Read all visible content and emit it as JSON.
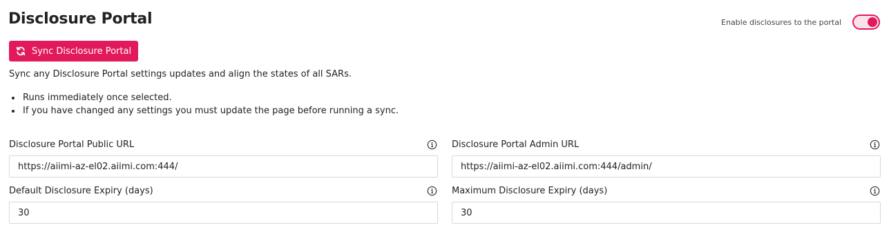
{
  "header": {
    "title": "Disclosure Portal",
    "toggle_label": "Enable disclosures to the portal",
    "toggle_on": true
  },
  "sync": {
    "button_label": "Sync Disclosure Portal",
    "description": "Sync any Disclosure Portal settings updates and align the states of all SARs.",
    "bullets": [
      "Runs immediately once selected.",
      "If you have changed any settings you must update the page before running a sync."
    ]
  },
  "fields": {
    "public_url": {
      "label": "Disclosure Portal Public URL",
      "value": "https://aiimi-az-el02.aiimi.com:444/"
    },
    "admin_url": {
      "label": "Disclosure Portal Admin URL",
      "value": "https://aiimi-az-el02.aiimi.com:444/admin/"
    },
    "default_expiry": {
      "label": "Default Disclosure Expiry (days)",
      "value": "30"
    },
    "max_expiry": {
      "label": "Maximum Disclosure Expiry (days)",
      "value": "30"
    }
  },
  "colors": {
    "accent": "#e2195b",
    "accent_light": "#fbe2ea"
  },
  "icons": {
    "sync_button": "sync-icon",
    "field_help": "info-icon"
  }
}
